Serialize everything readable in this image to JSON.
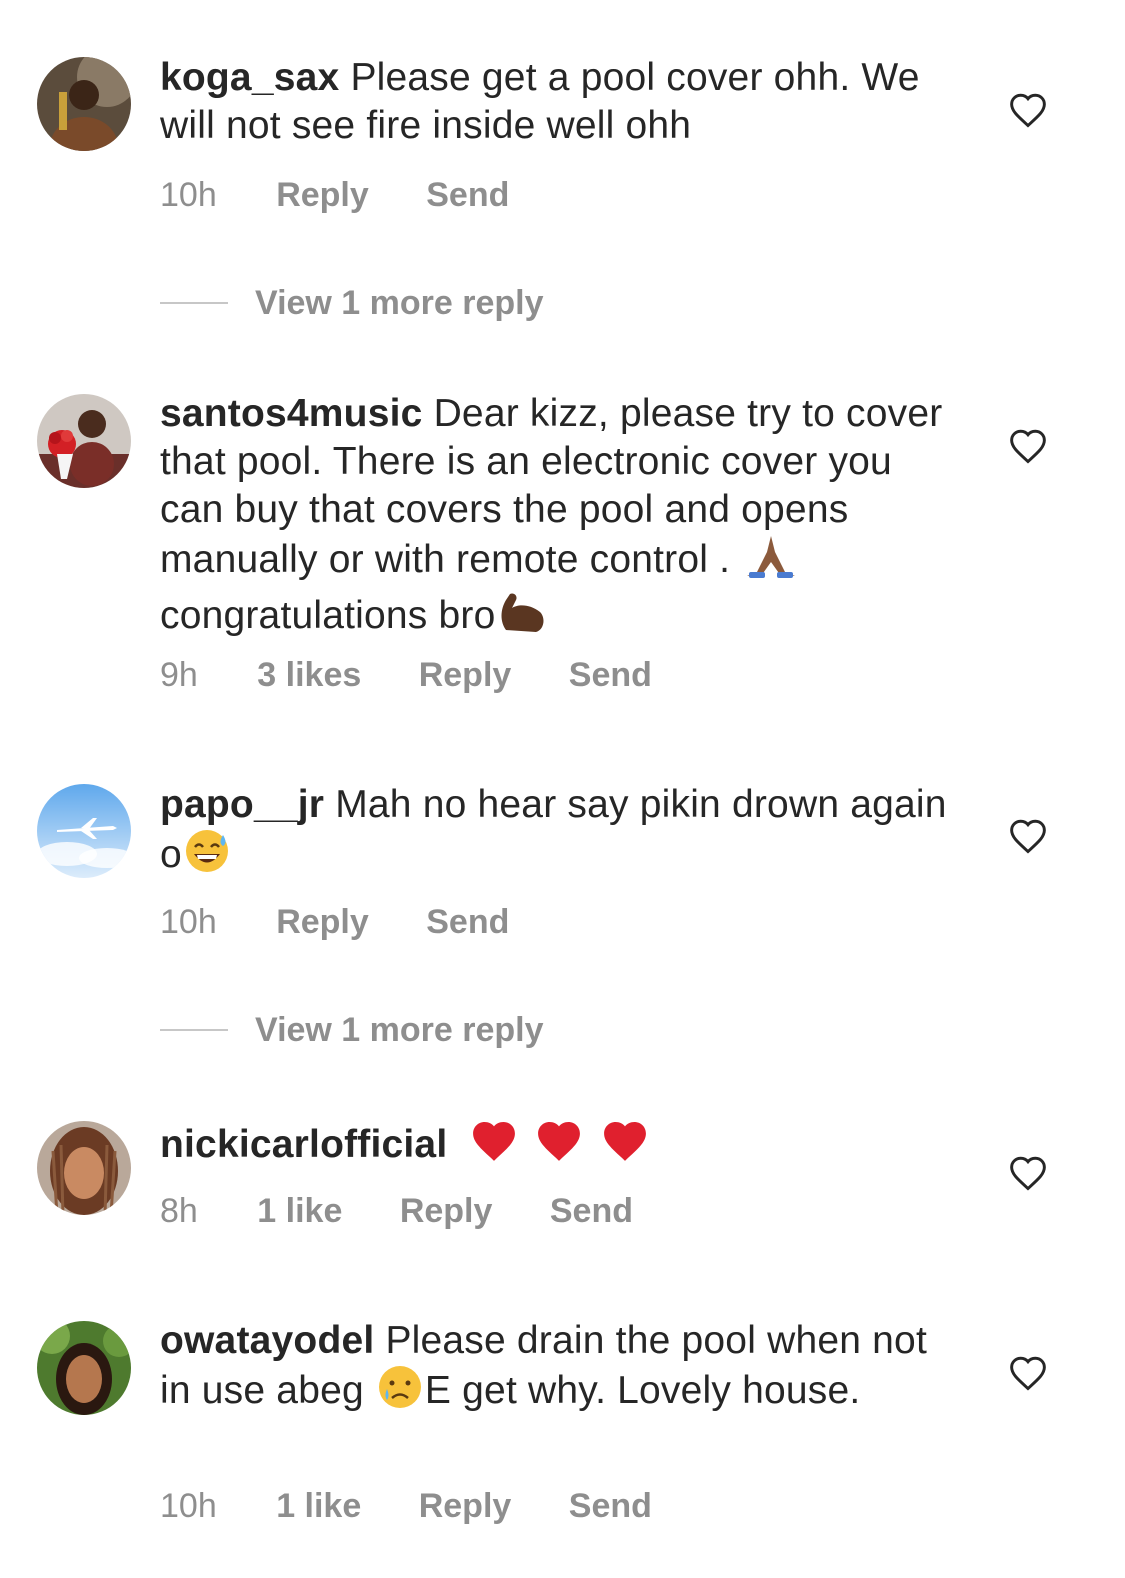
{
  "comments": [
    {
      "username": "koga_sax",
      "text": "Please get a pool cover ohh. We will not see fire inside well ohh",
      "time": "10h",
      "likes": "",
      "reply_label": "Reply",
      "send_label": "Send",
      "view_more": "View 1 more reply"
    },
    {
      "username": "santos4music",
      "text": "Dear kizz, please try to cover that pool. There is an electronic cover you can buy that covers the pool and opens manually or with remote control .",
      "text_after": "congratulations bro",
      "time": "9h",
      "likes": "3 likes",
      "reply_label": "Reply",
      "send_label": "Send"
    },
    {
      "username": "papo__jr",
      "text": "Mah no hear say pikin drown again o",
      "time": "10h",
      "likes": "",
      "reply_label": "Reply",
      "send_label": "Send",
      "view_more": "View 1 more reply"
    },
    {
      "username": "nickicarlofficial",
      "text": "",
      "time": "8h",
      "likes": "1 like",
      "reply_label": "Reply",
      "send_label": "Send"
    },
    {
      "username": "owatayodel",
      "text": "Please drain the pool when not in use abeg",
      "text_after": "E get why. Lovely house.",
      "time": "10h",
      "likes": "1 like",
      "reply_label": "Reply",
      "send_label": "Send"
    }
  ],
  "icons": {
    "heart": "heart-outline-icon",
    "pray": "folded-hands-emoji",
    "muscle": "flexed-biceps-emoji",
    "sweat_smile": "grinning-sweat-emoji",
    "red_heart": "red-heart-emoji",
    "cry": "crying-face-emoji"
  },
  "colors": {
    "text": "#262626",
    "meta": "#8e8e8e",
    "heart_emoji": "#e0202e"
  }
}
